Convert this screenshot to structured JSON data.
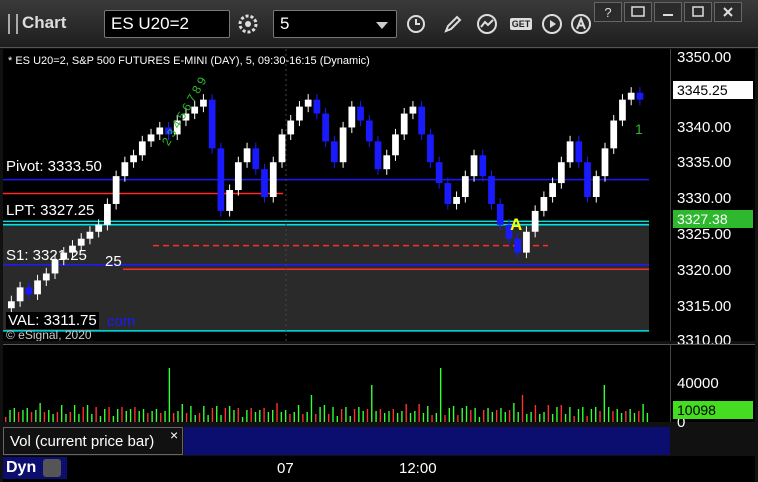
{
  "toolbar": {
    "title": "Chart",
    "symbol": "ES U20=2",
    "interval": "5",
    "get_label": "GET"
  },
  "chart": {
    "header": "* ES U20=2, S&P 500 FUTURES E-MINI (DAY), 5, 09:30-16:15 (Dynamic)",
    "copyright": "© eSignal, 2020",
    "watermark": "com",
    "price_ticks": [
      "3350.00",
      "3345.00",
      "3340.00",
      "3335.00",
      "3330.00",
      "3325.00",
      "3320.00",
      "3315.00",
      "3310.00"
    ],
    "last_price": "3345.25",
    "lpt_price": "3327.38",
    "levels": {
      "pivot": "Pivot: 3333.50",
      "lpt": "LPT: 3327.25",
      "s1": "S1: 3321.25",
      "s1_overlap": "25",
      "val": "VAL: 3311.75",
      "overlap_fragment": "E..."
    },
    "annotations": {
      "a_marker": "A",
      "one_marker": "1",
      "green_count": "2 3 4 5 6 7 8 9"
    },
    "colors": {
      "up": "#ffffff",
      "down": "#1a1aff",
      "pivot": "#1a1aff",
      "resistance": "#ff2a2a",
      "support": "#00e5e5",
      "last_badge": "#ffffff",
      "lpt_badge": "#2db82d"
    }
  },
  "volume": {
    "legend": "Vol (current price bar)",
    "close_glyph": "×",
    "tick_40000": "40000",
    "tick_0": "0",
    "last_value": "10098"
  },
  "time_axis": {
    "labels": [
      "07",
      "12:00"
    ]
  },
  "status": {
    "dyn": "Dyn"
  },
  "chart_data": {
    "type": "candlestick",
    "title": "ES U20=2, S&P 500 FUTURES E-MINI (DAY), 5, 09:30-16:15 (Dynamic)",
    "ylim": [
      3310,
      3352
    ],
    "x_labels": [
      "07",
      "12:00"
    ],
    "horizontal_levels": [
      {
        "name": "Pivot",
        "value": 3333.5
      },
      {
        "name": "LPT",
        "value": 3327.25
      },
      {
        "name": "S1",
        "value": 3321.25
      },
      {
        "name": "VAL",
        "value": 3311.75
      }
    ],
    "closes": [
      3316,
      3318,
      3317,
      3319,
      3320,
      3322,
      3323,
      3324,
      3325,
      3326,
      3327,
      3330,
      3334,
      3336,
      3337,
      3339,
      3340,
      3341,
      3340,
      3342,
      3343,
      3344,
      3345,
      3338,
      3329,
      3332,
      3336,
      3338,
      3335,
      3331,
      3336,
      3340,
      3342,
      3344,
      3345,
      3343,
      3339,
      3336,
      3341,
      3344,
      3342,
      3339,
      3335,
      3337,
      3340,
      3343,
      3344,
      3340,
      3336,
      3333,
      3330,
      3331,
      3334,
      3337,
      3334,
      3330,
      3327,
      3325,
      3323,
      3326,
      3329,
      3331,
      3333,
      3336,
      3339,
      3336,
      3331,
      3334,
      3338,
      3342,
      3345,
      3346,
      3345
    ]
  }
}
